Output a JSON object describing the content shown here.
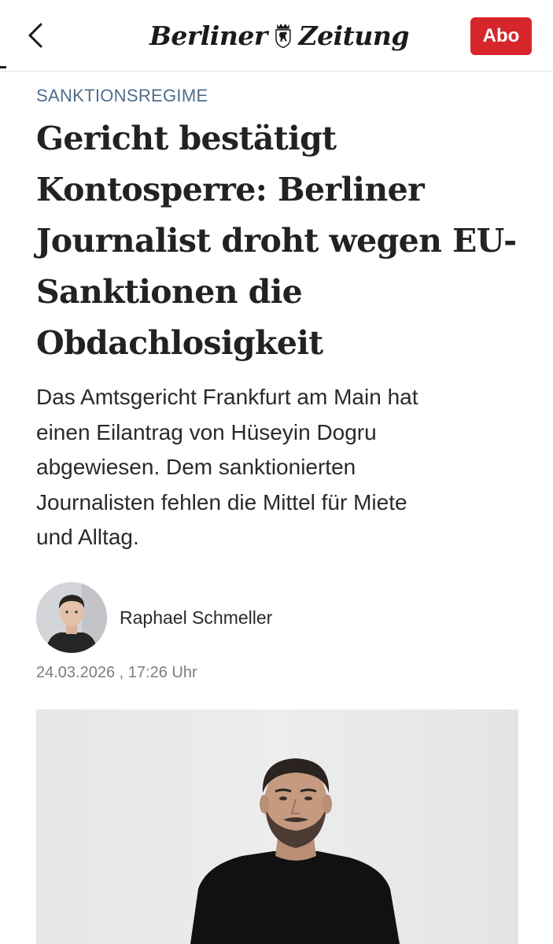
{
  "header": {
    "back_icon": "chevron-left-icon",
    "logo": {
      "word_left": "Berliner",
      "word_right": "Zeitung",
      "crest_icon": "berlin-bear-crest-icon"
    },
    "abo_label": "Abo",
    "abo_color": "#d7262b"
  },
  "article": {
    "kicker": "SANKTIONSREGIME",
    "kicker_color": "#4f6e8a",
    "headline_lines": [
      "Gericht bestätigt",
      "Kontosperre: Berliner",
      "Journalist droht wegen EU-",
      "Sanktionen die",
      "Obdachlosigkeit"
    ],
    "lead_lines": [
      "Das Amtsgericht Frankfurt am Main hat",
      "einen Eilantrag von Hüseyin Dogru",
      "abgewiesen. Dem sanktionierten",
      "Journalisten fehlen die Mittel für Miete",
      "und Alltag."
    ],
    "author": {
      "name": "Raphael Schmeller",
      "avatar_icon": "author-portrait"
    },
    "date": "24.03.2026 , 17:26 Uhr",
    "hero_image": "portrait-photo"
  }
}
